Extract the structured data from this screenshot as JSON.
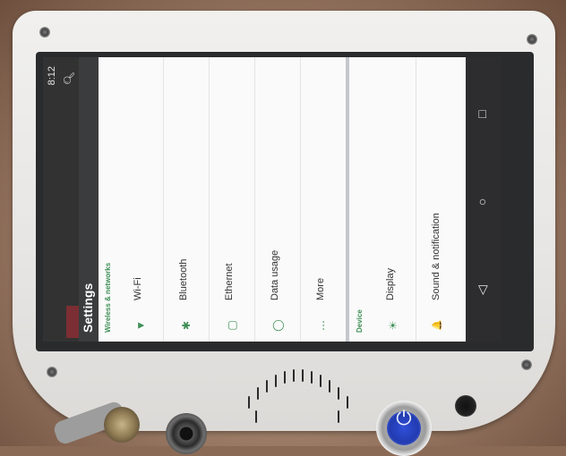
{
  "status_bar": {
    "time": "8:12",
    "search_icon": "search-icon"
  },
  "app_bar": {
    "title": "Settings"
  },
  "sections": {
    "wireless_header": "Wireless & networks",
    "device_header": "Device"
  },
  "wireless_items": [
    {
      "label": "Wi-Fi",
      "icon": "wifi-icon",
      "glyph": "▼"
    },
    {
      "label": "Bluetooth",
      "icon": "bluetooth-icon",
      "glyph": "✱"
    },
    {
      "label": "Ethernet",
      "icon": "ethernet-icon",
      "glyph": "▢"
    },
    {
      "label": "Data usage",
      "icon": "data-usage-icon",
      "glyph": "◯"
    },
    {
      "label": "More",
      "icon": "more-icon",
      "glyph": "⋯"
    }
  ],
  "device_items": [
    {
      "label": "Display",
      "icon": "display-icon",
      "glyph": "☀"
    },
    {
      "label": "Sound & notification",
      "icon": "sound-notification-icon",
      "glyph": "🔔"
    }
  ],
  "navigation": {
    "back_icon": "back-icon",
    "home_icon": "home-icon",
    "recents_icon": "recents-icon",
    "back_glyph": "◁",
    "home_glyph": "○",
    "recents_glyph": "□"
  },
  "colors": {
    "accent": "#3f8f56",
    "status_bar": "#323232",
    "power_ring": "#2f4fd8"
  }
}
